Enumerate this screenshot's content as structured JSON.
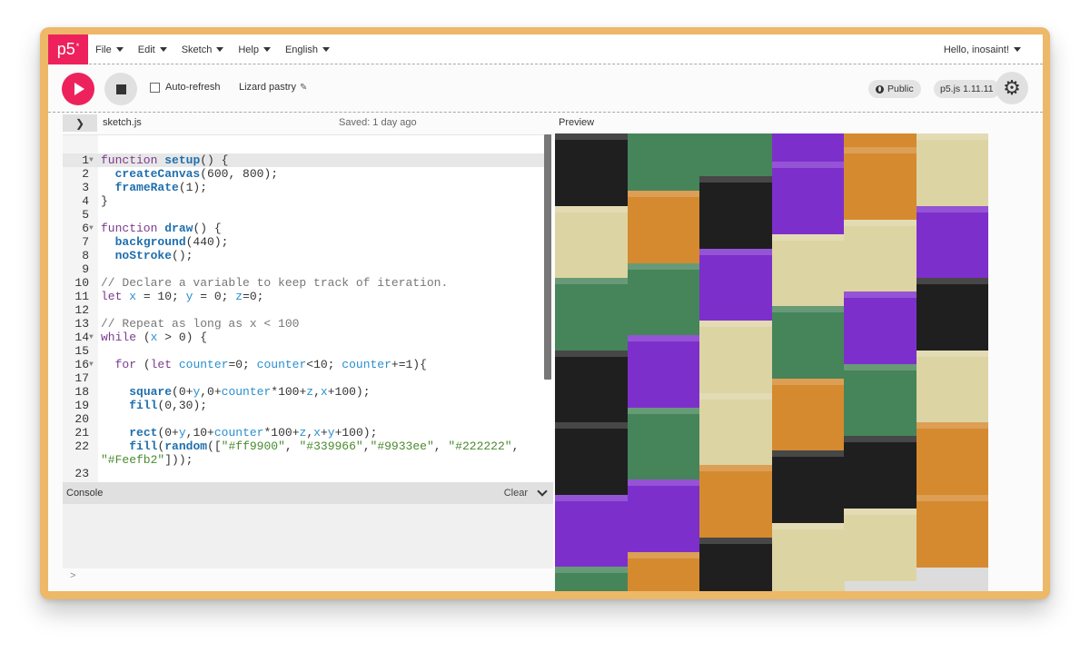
{
  "nav": {
    "logo": "p5",
    "logo_sup": "*",
    "menus": [
      "File",
      "Edit",
      "Sketch",
      "Help",
      "English"
    ],
    "user_greeting": "Hello, inosaint!"
  },
  "toolbar": {
    "auto_refresh_label": "Auto-refresh",
    "auto_refresh_checked": false,
    "sketch_name": "Lizard pastry",
    "visibility": "Public",
    "version": "p5.js 1.11.11"
  },
  "editor": {
    "filename": "sketch.js",
    "saved_status": "Saved: 1 day ago",
    "active_line": 1,
    "lines": [
      {
        "n": "1",
        "fold": true,
        "text": "function setup() {"
      },
      {
        "n": "2",
        "fold": false,
        "text": "  createCanvas(600, 800);"
      },
      {
        "n": "3",
        "fold": false,
        "text": "  frameRate(1);"
      },
      {
        "n": "4",
        "fold": false,
        "text": "}"
      },
      {
        "n": "5",
        "fold": false,
        "text": ""
      },
      {
        "n": "6",
        "fold": true,
        "text": "function draw() {"
      },
      {
        "n": "7",
        "fold": false,
        "text": "  background(440);"
      },
      {
        "n": "8",
        "fold": false,
        "text": "  noStroke();"
      },
      {
        "n": "9",
        "fold": false,
        "text": ""
      },
      {
        "n": "10",
        "fold": false,
        "text": "// Declare a variable to keep track of iteration."
      },
      {
        "n": "11",
        "fold": false,
        "text": "let x = 10; y = 0; z=0;"
      },
      {
        "n": "12",
        "fold": false,
        "text": ""
      },
      {
        "n": "13",
        "fold": false,
        "text": "// Repeat as long as x < 100"
      },
      {
        "n": "14",
        "fold": true,
        "text": "while (x > 0) {"
      },
      {
        "n": "15",
        "fold": false,
        "text": ""
      },
      {
        "n": "16",
        "fold": true,
        "text": "  for (let counter=0; counter<10; counter+=1){"
      },
      {
        "n": "17",
        "fold": false,
        "text": ""
      },
      {
        "n": "18",
        "fold": false,
        "text": "    square(0+y,0+counter*100+z,x+100);"
      },
      {
        "n": "19",
        "fold": false,
        "text": "    fill(0,30);"
      },
      {
        "n": "20",
        "fold": false,
        "text": ""
      },
      {
        "n": "21",
        "fold": false,
        "text": "    rect(0+y,10+counter*100+z,x+y+100);"
      },
      {
        "n": "22",
        "fold": false,
        "text": "    fill(random([\"#ff9900\", \"#339966\",\"#9933ee\", \"#222222\","
      },
      {
        "n": "",
        "fold": false,
        "text": "\"#Feefb2\"]));"
      },
      {
        "n": "23",
        "fold": false,
        "text": ""
      }
    ]
  },
  "console": {
    "title": "Console",
    "clear_label": "Clear",
    "prompt": ">"
  },
  "preview": {
    "label": "Preview",
    "palette": {
      "orange": "#d58a30",
      "green": "#46845a",
      "purple": "#7d2fcc",
      "black": "#1f1f1f",
      "cream": "#ddd4a4"
    },
    "columns": [
      [
        "black",
        "cream",
        "green",
        "black",
        "black",
        "purple",
        "green"
      ],
      [
        "green",
        "orange",
        "green",
        "purple",
        "green",
        "purple",
        "orange"
      ],
      [
        "green",
        "black",
        "purple",
        "cream",
        "cream",
        "orange",
        "black"
      ],
      [
        "purple",
        "purple",
        "cream",
        "green",
        "orange",
        "black",
        "cream"
      ],
      [
        "orange",
        "orange",
        "cream",
        "purple",
        "green",
        "black",
        "cream"
      ],
      [
        "cream",
        "cream",
        "purple",
        "black",
        "cream",
        "orange",
        "orange"
      ]
    ],
    "icons": [
      "play-icon",
      "stop-icon",
      "globe-icon",
      "gear-icon",
      "pencil-icon",
      "chevron-right-icon",
      "chevron-down-icon"
    ]
  }
}
